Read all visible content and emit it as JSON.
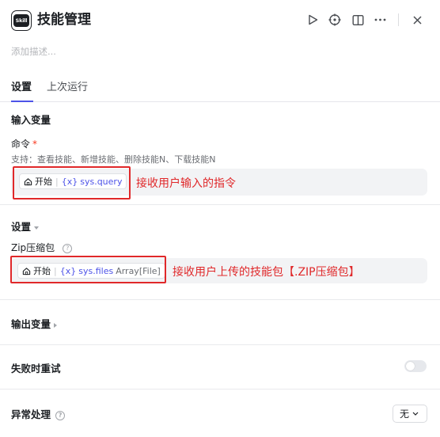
{
  "header": {
    "app_icon_text": "Skill",
    "title": "技能管理",
    "actions": [
      "play-icon",
      "locate-icon",
      "panel-icon",
      "more-icon",
      "close-icon"
    ]
  },
  "description_placeholder": "添加描述...",
  "tabs": [
    {
      "label": "设置",
      "active": true
    },
    {
      "label": "上次运行",
      "active": false
    }
  ],
  "input_section": {
    "title": "输入变量",
    "command": {
      "label": "命令",
      "required_mark": "*",
      "hint": "支持：查看技能、新增技能、删除技能N、下载技能N",
      "source_node": "开始",
      "variable_prefix": "{x}",
      "variable": "sys.query"
    },
    "annotation": "接收用户输入的指令"
  },
  "settings_section": {
    "title": "设置",
    "zip": {
      "label": "Zip压缩包",
      "help": "?",
      "source_node": "开始",
      "variable_prefix": "{x}",
      "variable": "sys.files",
      "type": "Array[File]"
    },
    "annotation": "接收用户上传的技能包【.ZIP压缩包】"
  },
  "output_section": {
    "title": "输出变量"
  },
  "retry_section": {
    "title": "失败时重试",
    "enabled": false
  },
  "error_section": {
    "title": "异常处理",
    "help": "?",
    "value": "无"
  },
  "colors": {
    "accent": "#4d53e8",
    "annotation_red": "#e0282a",
    "field_bg": "#f2f3f5"
  }
}
